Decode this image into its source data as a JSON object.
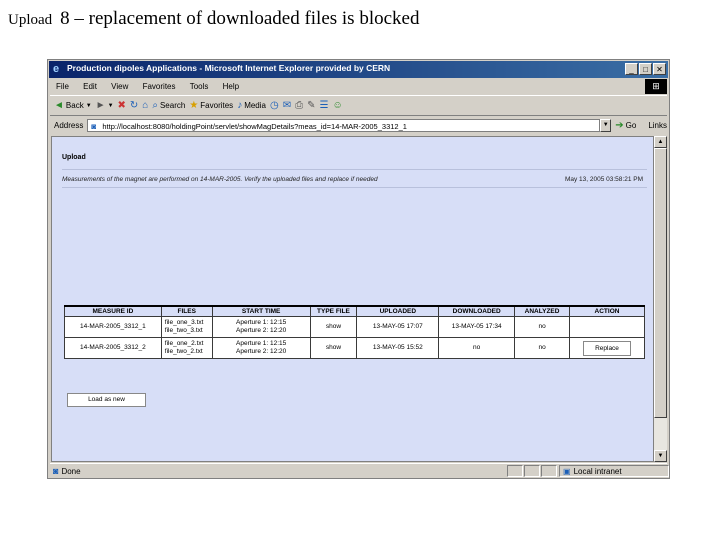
{
  "slide": {
    "title_word1": "Upload",
    "title_rest": "8 – replacement of downloaded files is blocked"
  },
  "window": {
    "title": "Production dipoles Applications - Microsoft Internet Explorer provided by CERN",
    "buttons": {
      "minimize": "_",
      "maximize": "□",
      "close": "✕"
    }
  },
  "menu": [
    "File",
    "Edit",
    "View",
    "Favorites",
    "Tools",
    "Help"
  ],
  "toolbar": {
    "back": "Back",
    "search": "Search",
    "favorites": "Favorites",
    "media": "Media"
  },
  "address": {
    "label": "Address",
    "url": "http://localhost:8080/holdingPoint/servlet/showMagDetails?meas_id=14-MAR-2005_3312_1",
    "go": "Go",
    "links": "Links"
  },
  "page": {
    "title": "Upload",
    "description": "Measurements of the magnet are performed on 14-MAR-2005. Verify the uploaded files and replace if needed",
    "date": "May 13, 2005 03:58:21 PM",
    "table": {
      "headers": [
        "MEASURE ID",
        "FILES",
        "START TIME",
        "TYPE FILE",
        "UPLOADED",
        "DOWNLOADED",
        "ANALYZED",
        "ACTION"
      ],
      "rows": [
        {
          "measure_id": "14-MAR-2005_3312_1",
          "file1": "file_one_3.txt",
          "file2": "file_two_3.txt",
          "start1": "Aperture 1: 12:15",
          "start2": "Aperture 2: 12:20",
          "type_file": "show",
          "uploaded": "13-MAY-05 17:07",
          "downloaded": "13-MAY-05 17:34",
          "analyzed": "no",
          "action": ""
        },
        {
          "measure_id": "14-MAR-2005_3312_2",
          "file1": "file_one_2.txt",
          "file2": "file_two_2.txt",
          "start1": "Aperture 1: 12:15",
          "start2": "Aperture 2: 12:20",
          "type_file": "show",
          "uploaded": "13-MAY-05 15:52",
          "downloaded": "no",
          "analyzed": "no",
          "action": "Replace"
        }
      ]
    },
    "load_button": "Load as new"
  },
  "status": {
    "left": "Done",
    "zone": "Local intranet"
  }
}
